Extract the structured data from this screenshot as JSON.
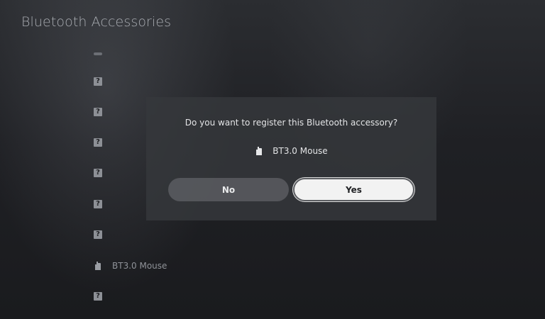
{
  "page": {
    "title": "Bluetooth Accessories"
  },
  "devices": [
    {
      "icon": "loading-icon",
      "label": ""
    },
    {
      "icon": "unknown-device-icon",
      "glyph": "?",
      "label": ""
    },
    {
      "icon": "unknown-device-icon",
      "glyph": "?",
      "label": ""
    },
    {
      "icon": "unknown-device-icon",
      "glyph": "?",
      "label": ""
    },
    {
      "icon": "unknown-device-icon",
      "glyph": "?",
      "label": ""
    },
    {
      "icon": "unknown-device-icon",
      "glyph": "?",
      "label": ""
    },
    {
      "icon": "unknown-device-icon",
      "glyph": "?",
      "label": ""
    },
    {
      "icon": "mouse-icon",
      "label": "BT3.0 Mouse"
    },
    {
      "icon": "unknown-device-icon",
      "glyph": "?",
      "label": ""
    }
  ],
  "dialog": {
    "question": "Do you want to register this Bluetooth accessory?",
    "device_icon": "mouse-icon",
    "device_name": "BT3.0 Mouse",
    "no_label": "No",
    "yes_label": "Yes",
    "focused_button": "yes"
  }
}
